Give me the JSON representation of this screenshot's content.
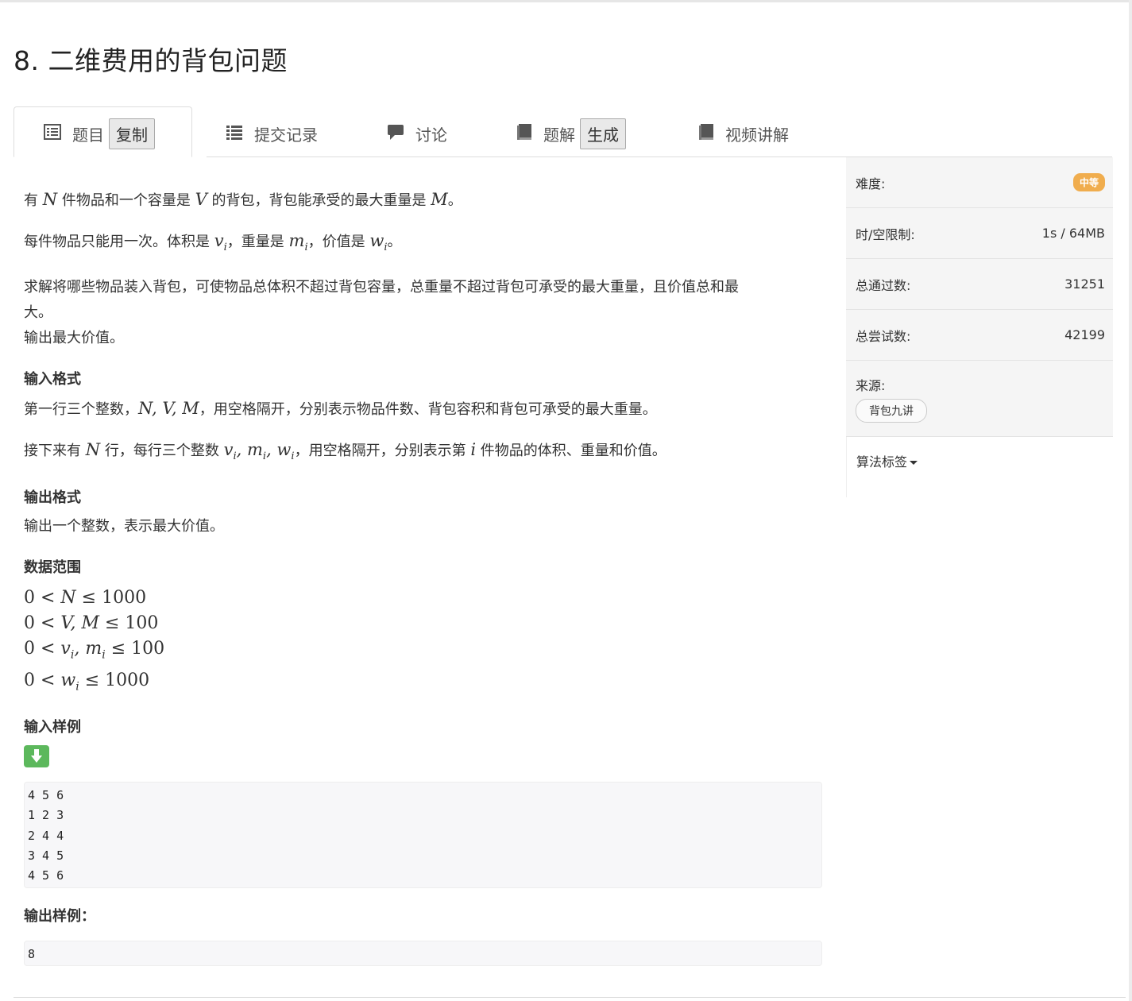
{
  "title": "8. 二维费用的背包问题",
  "tabs": [
    {
      "label": "题目",
      "button": "复制",
      "icon": "list-alt-icon"
    },
    {
      "label": "提交记录",
      "icon": "list-icon"
    },
    {
      "label": "讨论",
      "icon": "comment-icon"
    },
    {
      "label": "题解",
      "button": "生成",
      "icon": "book-icon"
    },
    {
      "label": "视频讲解",
      "icon": "book-icon"
    }
  ],
  "sidebar": {
    "difficulty_label": "难度:",
    "difficulty_value": "中等",
    "limit_label": "时/空限制:",
    "limit_value": "1s / 64MB",
    "accepted_label": "总通过数:",
    "accepted_value": "31251",
    "attempts_label": "总尝试数:",
    "attempts_value": "42199",
    "source_label": "来源:",
    "source_tag": "背包九讲",
    "tags_label": "算法标签"
  },
  "problem": {
    "p1_a": "有 ",
    "p1_N": "N",
    "p1_b": " 件物品和一个容量是 ",
    "p1_V": "V",
    "p1_c": " 的背包，背包能承受的最大重量是 ",
    "p1_M": "M",
    "p1_d": "。",
    "p2_a": "每件物品只能用一次。体积是 ",
    "p2_v": "v",
    "p2_b": "，重量是 ",
    "p2_m": "m",
    "p2_c": "，价值是 ",
    "p2_w": "w",
    "p2_d": "。",
    "sub_i": "i",
    "p3_line1": "求解将哪些物品装入背包，可使物品总体积不超过背包容量，总重量不超过背包可承受的最大重量，且价值总和最",
    "p3_line2": "大。",
    "p3_line3": "输出最大价值。",
    "input_heading": "输入格式",
    "input_p1_a": "第一行三个整数，",
    "input_p1_math": "N, V, M",
    "input_p1_b": "，用空格隔开，分别表示物品件数、背包容积和背包可承受的最大重量。",
    "input_p2_a": "接下来有 ",
    "input_p2_N": "N",
    "input_p2_b": " 行，每行三个整数 ",
    "input_p2_c": "，用空格隔开，分别表示第 ",
    "input_p2_i": "i",
    "input_p2_d": " 件物品的体积、重量和价值。",
    "output_heading": "输出格式",
    "output_p": "输出一个整数，表示最大价值。",
    "range_heading": "数据范围",
    "range1_a": "0 < ",
    "range1_var": "N",
    "range1_b": " ≤ 1000",
    "range2_a": "0 < ",
    "range2_var": "V, M",
    "range2_b": " ≤ 100",
    "range3_a": "0 < ",
    "range3_v": "v",
    "range3_m": "m",
    "range3_b": " ≤ 100",
    "range4_a": "0 < ",
    "range4_w": "w",
    "range4_b": " ≤ 1000",
    "sample_in_heading": "输入样例",
    "sample_in": "4 5 6\n1 2 3\n2 4 4\n3 4 5\n4 5 6",
    "sample_out_heading": "输出样例：",
    "sample_out": "8"
  },
  "colors": {
    "difficulty_badge": "#f0ad4e",
    "copy_button": "#5cb85c"
  }
}
